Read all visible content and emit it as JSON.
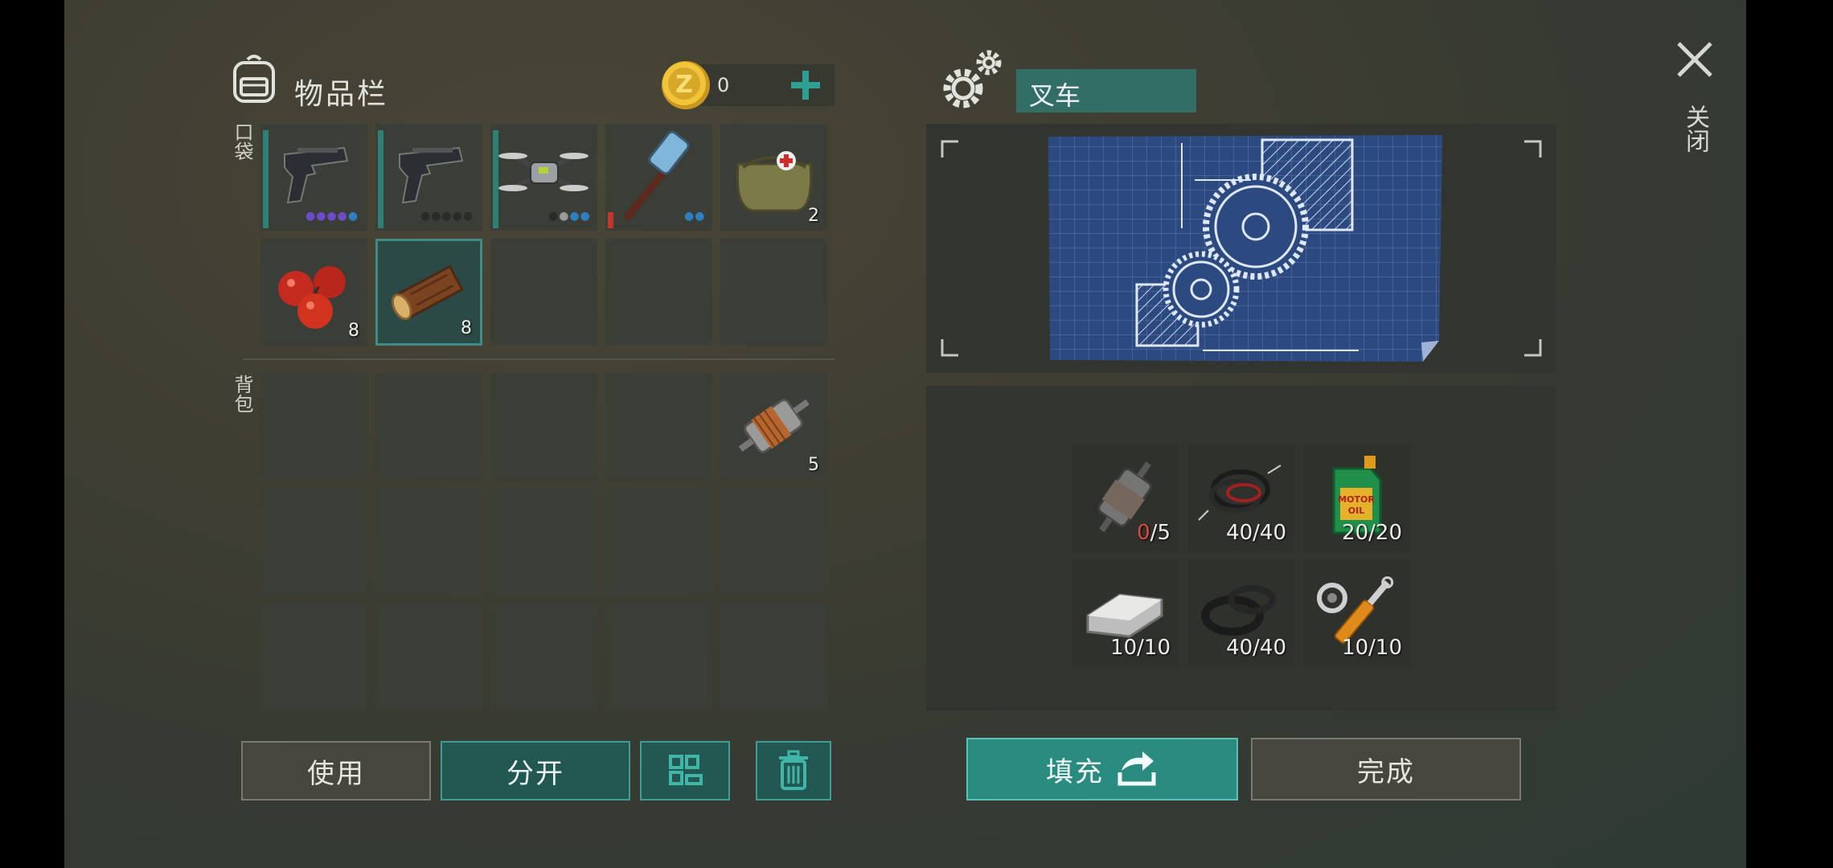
{
  "inventory": {
    "title": "物品栏",
    "coins": "0",
    "pocket_label": "口袋",
    "backpack_label": "背包",
    "pocket_slots": [
      {
        "item": "pistol",
        "count": "",
        "icon": "pistol-icon"
      },
      {
        "item": "pistol",
        "count": "",
        "icon": "pistol-icon"
      },
      {
        "item": "drone",
        "count": "",
        "icon": "drone-icon"
      },
      {
        "item": "hammer",
        "count": "",
        "icon": "hammer-icon"
      },
      {
        "item": "first-aid bag",
        "count": "2",
        "icon": "first-aid-bag-icon"
      },
      {
        "item": "apples",
        "count": "8",
        "icon": "apple-icon"
      },
      {
        "item": "log",
        "count": "8",
        "icon": "log-icon"
      }
    ],
    "backpack_slots": [
      {
        "item": "electric motor",
        "count": "5",
        "icon": "motor-icon"
      }
    ]
  },
  "buttons": {
    "use": "使用",
    "split": "分开",
    "fill": "填充",
    "done": "完成"
  },
  "crafting": {
    "name": "叉车",
    "recipe": [
      {
        "icon": "motor-icon",
        "have": "0",
        "need": "/5"
      },
      {
        "icon": "wire-icon",
        "have": "40",
        "need": "/40"
      },
      {
        "icon": "motor-oil-icon",
        "have": "20",
        "need": "/20"
      },
      {
        "icon": "metal-ingot-icon",
        "have": "10",
        "need": "/10"
      },
      {
        "icon": "rubber-seal-icon",
        "have": "40",
        "need": "/40"
      },
      {
        "icon": "hydraulic-cylinder-icon",
        "have": "10",
        "need": "/10"
      }
    ]
  },
  "close_label": "关闭",
  "colors": {
    "accent": "#2f9f93",
    "missing": "#e0473d"
  }
}
